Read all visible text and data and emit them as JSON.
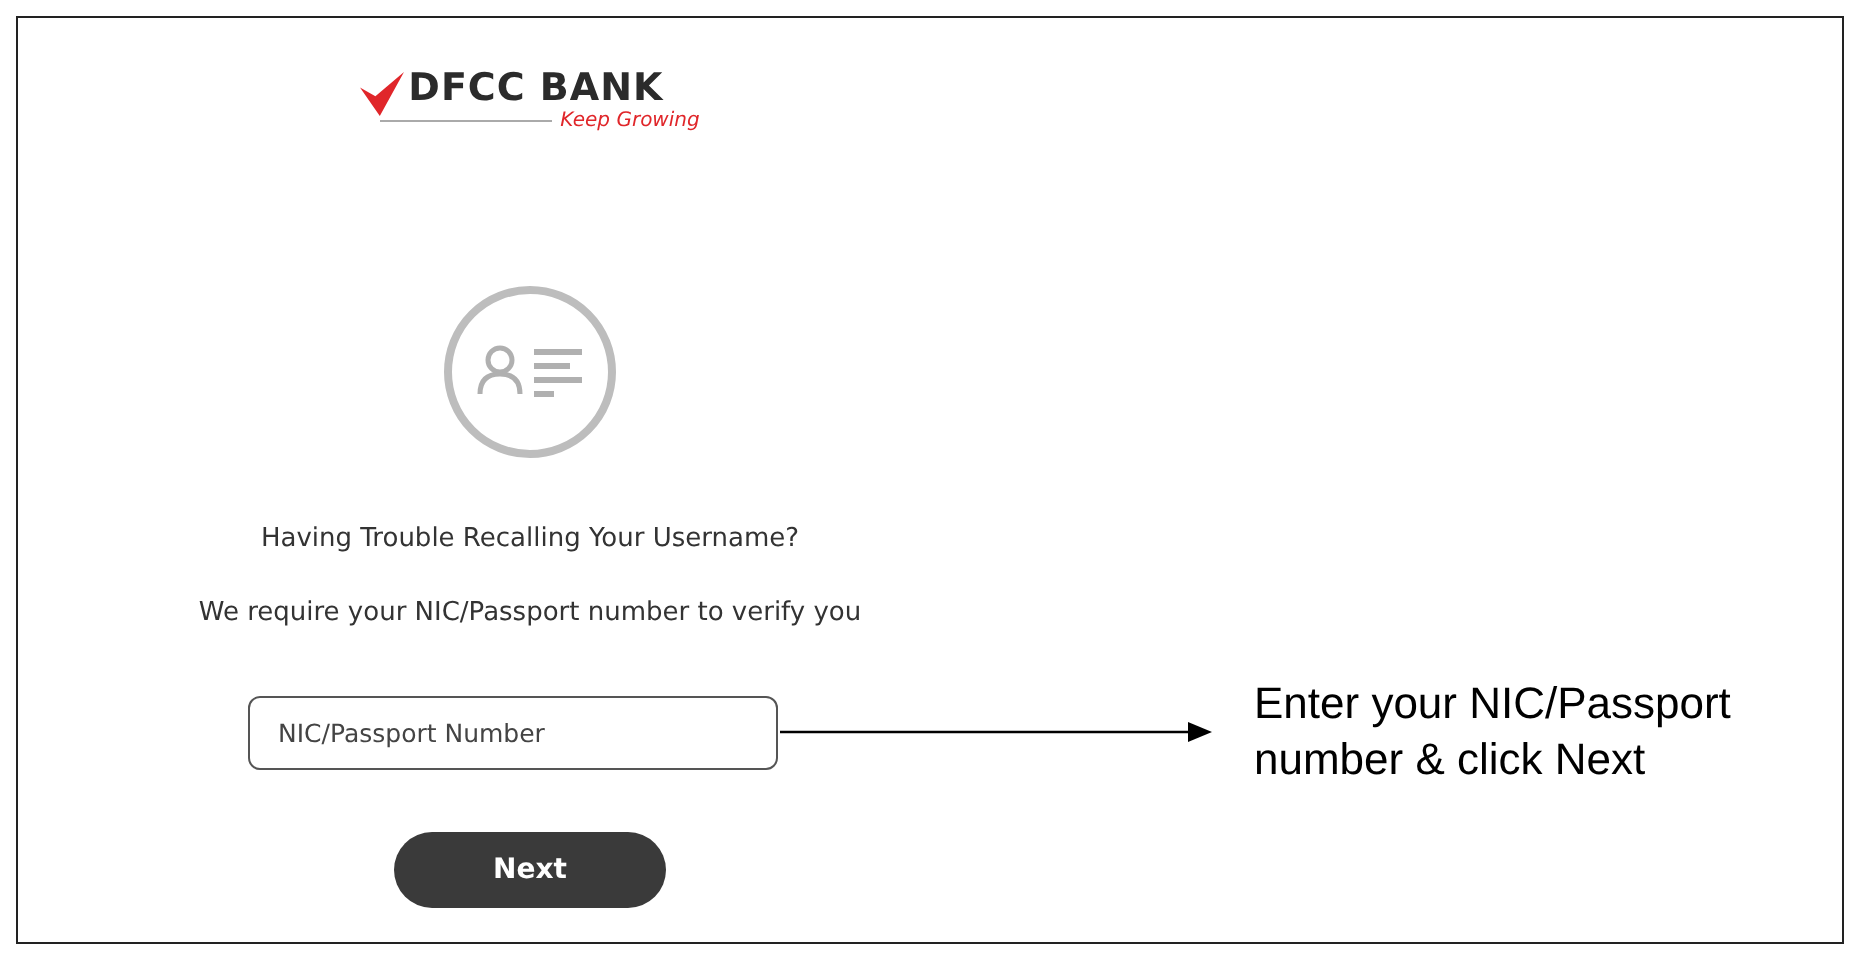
{
  "logo": {
    "name": "DFCC BANK",
    "tagline": "Keep Growing"
  },
  "title": "Having Trouble Recalling Your Username?",
  "instruction": "We require your NIC/Passport number to verify you",
  "nic_field": {
    "placeholder": "NIC/Passport Number"
  },
  "next_button": "Next",
  "annotation": "Enter your NIC/Passport number & click Next"
}
